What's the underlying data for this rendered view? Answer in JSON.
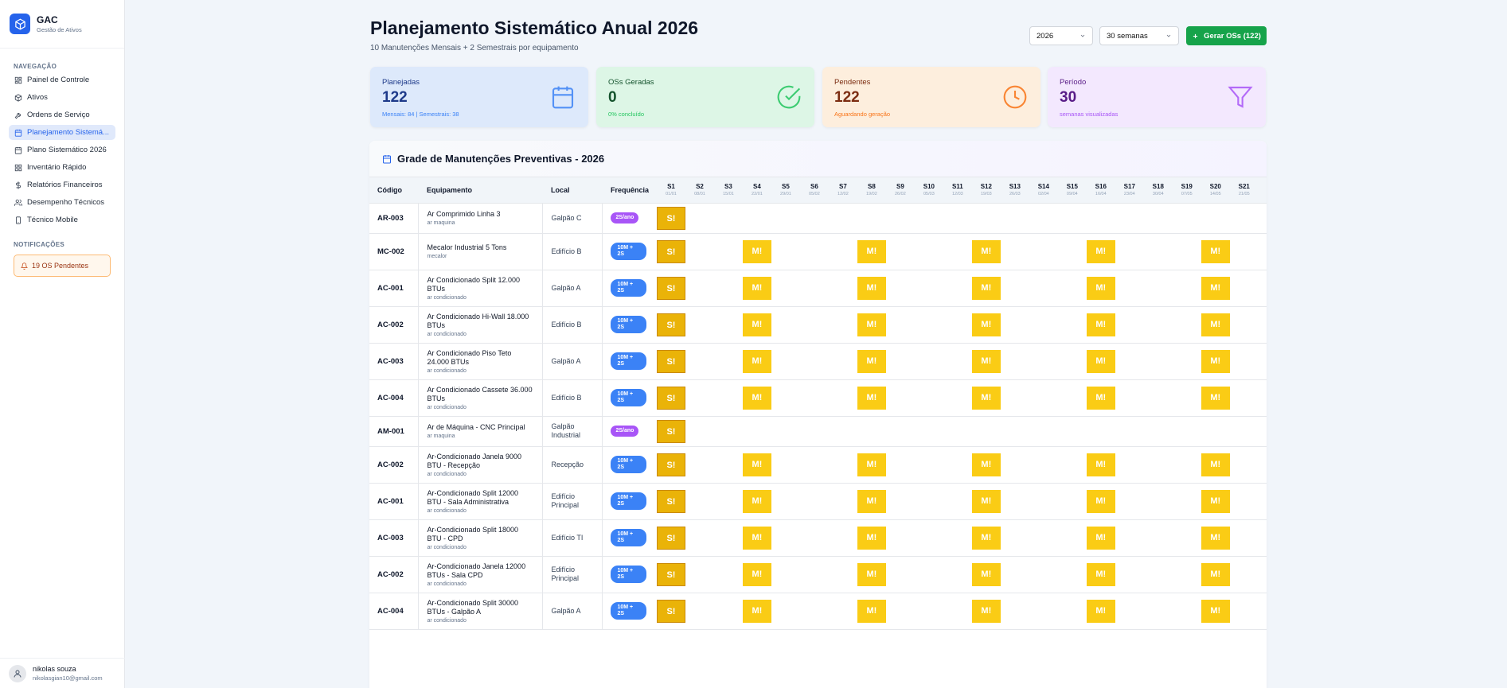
{
  "sidebar": {
    "brand_name": "GAC",
    "brand_sub": "Gestão de Ativos",
    "nav_label": "NAVEGAÇÃO",
    "items": [
      {
        "label": "Painel de Controle",
        "icon": "dashboard-icon"
      },
      {
        "label": "Ativos",
        "icon": "package-icon"
      },
      {
        "label": "Ordens de Serviço",
        "icon": "wrench-icon"
      },
      {
        "label": "Planejamento Sistemá...",
        "icon": "calendar-icon",
        "active": true
      },
      {
        "label": "Plano Sistemático 2026",
        "icon": "calendar-icon"
      },
      {
        "label": "Inventário Rápido",
        "icon": "grid-icon"
      },
      {
        "label": "Relatórios Financeiros",
        "icon": "dollar-icon"
      },
      {
        "label": "Desempenho Técnicos",
        "icon": "users-icon"
      },
      {
        "label": "Técnico Mobile",
        "icon": "phone-icon"
      }
    ],
    "notif_label": "NOTIFICAÇÕES",
    "notif_text": "19 OS Pendentes",
    "user_name": "nikolas souza",
    "user_email": "nikolasgian10@gmail.com"
  },
  "header": {
    "title": "Planejamento Sistemático Anual 2026",
    "subtitle": "10 Manutenções Mensais + 2 Semestrais por equipamento",
    "year_value": "2026",
    "weeks_value": "30 semanas",
    "generate_label": "Gerar OSs (122)"
  },
  "cards": [
    {
      "label": "Planejadas",
      "value": "122",
      "note": "Mensais: 84 | Semestrais: 38",
      "icon": "calendar-icon",
      "bg": "#dde9fb",
      "fg": "#1e3a8a",
      "accent": "#3b82f6"
    },
    {
      "label": "OSs Geradas",
      "value": "0",
      "note": "0% concluído",
      "icon": "check-circle-icon",
      "bg": "#ddf6e6",
      "fg": "#14532d",
      "accent": "#22c55e"
    },
    {
      "label": "Pendentes",
      "value": "122",
      "note": "Aguardando geração",
      "icon": "clock-icon",
      "bg": "#fdeedd",
      "fg": "#7c2d12",
      "accent": "#f97316"
    },
    {
      "label": "Período",
      "value": "30",
      "note": "semanas visualizadas",
      "icon": "filter-icon",
      "bg": "#f3e8fe",
      "fg": "#581c87",
      "accent": "#a855f7"
    }
  ],
  "grid": {
    "title": "Grade de Manutenções Preventivas - 2026",
    "columns": [
      "Código",
      "Equipamento",
      "Local",
      "Frequência"
    ],
    "weeks": [
      {
        "label": "S1",
        "date": "01/01"
      },
      {
        "label": "S2",
        "date": "08/01"
      },
      {
        "label": "S3",
        "date": "15/01"
      },
      {
        "label": "S4",
        "date": "22/01"
      },
      {
        "label": "S5",
        "date": "29/01"
      },
      {
        "label": "S6",
        "date": "05/02"
      },
      {
        "label": "S7",
        "date": "12/02"
      },
      {
        "label": "S8",
        "date": "19/02"
      },
      {
        "label": "S9",
        "date": "26/02"
      },
      {
        "label": "S10",
        "date": "05/03"
      },
      {
        "label": "S11",
        "date": "12/03"
      },
      {
        "label": "S12",
        "date": "19/03"
      },
      {
        "label": "S13",
        "date": "26/03"
      },
      {
        "label": "S14",
        "date": "02/04"
      },
      {
        "label": "S15",
        "date": "09/04"
      },
      {
        "label": "S16",
        "date": "16/04"
      },
      {
        "label": "S17",
        "date": "23/04"
      },
      {
        "label": "S18",
        "date": "30/04"
      },
      {
        "label": "S19",
        "date": "07/05"
      },
      {
        "label": "S20",
        "date": "14/05"
      },
      {
        "label": "S21",
        "date": "21/05"
      }
    ],
    "semester_mark": "S!",
    "monthly_mark": "M!",
    "semester_weeks": [
      1
    ],
    "monthly_weeks": [
      4,
      8,
      12,
      16,
      20
    ],
    "rows": [
      {
        "code": "AR-003",
        "name": "Ar Comprimido Linha 3",
        "cat": "ar maquina",
        "loc": "Galpão C",
        "freq": "2S/ano",
        "type": "p"
      },
      {
        "code": "MC-002",
        "name": "Mecalor Industrial 5 Tons",
        "cat": "mecalor",
        "loc": "Edifício B",
        "freq": "10M + 2S",
        "type": "b"
      },
      {
        "code": "AC-001",
        "name": "Ar Condicionado Split 12.000 BTUs",
        "cat": "ar condicionado",
        "loc": "Galpão A",
        "freq": "10M + 2S",
        "type": "b"
      },
      {
        "code": "AC-002",
        "name": "Ar Condicionado Hi-Wall 18.000 BTUs",
        "cat": "ar condicionado",
        "loc": "Edifício B",
        "freq": "10M + 2S",
        "type": "b"
      },
      {
        "code": "AC-003",
        "name": "Ar Condicionado Piso Teto 24.000 BTUs",
        "cat": "ar condicionado",
        "loc": "Galpão A",
        "freq": "10M + 2S",
        "type": "b"
      },
      {
        "code": "AC-004",
        "name": "Ar Condicionado Cassete 36.000 BTUs",
        "cat": "ar condicionado",
        "loc": "Edifício B",
        "freq": "10M + 2S",
        "type": "b"
      },
      {
        "code": "AM-001",
        "name": "Ar de Máquina - CNC Principal",
        "cat": "ar maquina",
        "loc": "Galpão Industrial",
        "freq": "2S/ano",
        "type": "p"
      },
      {
        "code": "AC-002",
        "name": "Ar-Condicionado Janela 9000 BTU - Recepção",
        "cat": "ar condicionado",
        "loc": "Recepção",
        "freq": "10M + 2S",
        "type": "b"
      },
      {
        "code": "AC-001",
        "name": "Ar-Condicionado Split 12000 BTU - Sala Administrativa",
        "cat": "ar condicionado",
        "loc": "Edifício Principal",
        "freq": "10M + 2S",
        "type": "b"
      },
      {
        "code": "AC-003",
        "name": "Ar-Condicionado Split 18000 BTU - CPD",
        "cat": "ar condicionado",
        "loc": "Edifício TI",
        "freq": "10M + 2S",
        "type": "b"
      },
      {
        "code": "AC-002",
        "name": "Ar-Condicionado Janela 12000 BTUs - Sala CPD",
        "cat": "ar condicionado",
        "loc": "Edifício Principal",
        "freq": "10M + 2S",
        "type": "b"
      },
      {
        "code": "AC-004",
        "name": "Ar-Condicionado Split 30000 BTUs - Galpão A",
        "cat": "ar condicionado",
        "loc": "Galpão A",
        "freq": "10M + 2S",
        "type": "b"
      }
    ]
  }
}
